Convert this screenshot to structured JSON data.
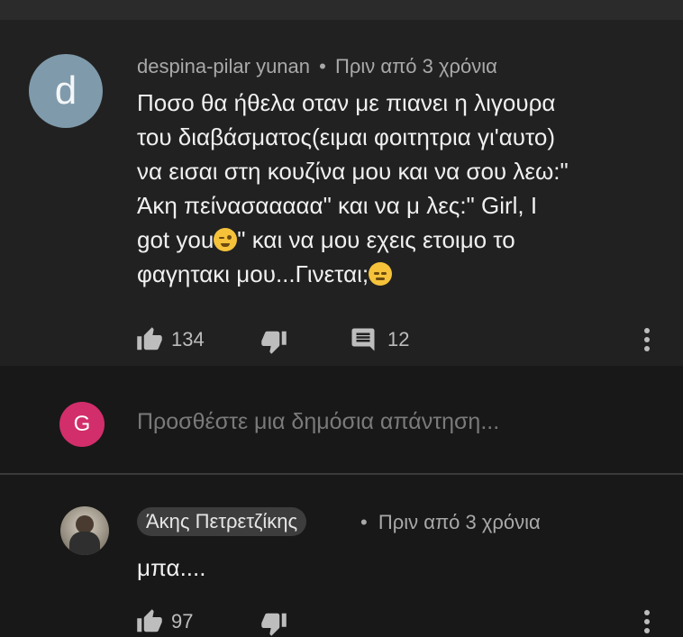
{
  "comment": {
    "avatar_letter": "d",
    "author": "despina-pilar yunan",
    "separator": "•",
    "time": "Πριν από 3 χρόνια",
    "lines": [
      "Ποσο θα ήθελα οταν με πιανει η λιγουρα",
      "του διαβάσματος(ειμαι φοιτητρια γι'αυτο)",
      "να εισαι στη κουζίνα μου και να σου λεω:\"",
      "Άκη πείνασααααα\" και να μ λες:\" Girl, I",
      "got you",
      "\" και να μου εχεις ετοιμο το",
      "φαγητακι μου...Γινεται;"
    ],
    "likes": "134",
    "replies": "12"
  },
  "reply_box": {
    "avatar_letter": "G",
    "placeholder": "Προσθέστε μια δημόσια απάντηση..."
  },
  "reply": {
    "author": "Άκης Πετρετζίκης",
    "separator": "•",
    "time": "Πριν από 3 χρόνια",
    "text": "μπα....",
    "likes": "97"
  },
  "colors": {
    "comment_bg": "#212121",
    "page_bg": "#181818",
    "avatar_d": "#7f9aab",
    "avatar_g": "#d22e6b",
    "author_chip": "#3d3d3d"
  },
  "icons": [
    "thumbs-up-icon",
    "thumbs-down-icon",
    "comment-icon",
    "more-vert-icon"
  ]
}
